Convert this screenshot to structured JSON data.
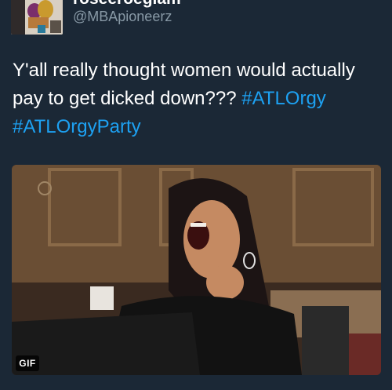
{
  "tweet": {
    "display_name": "roseeroeglam",
    "handle": "@MBApioneerz",
    "text_main": "Y'all really thought women would actually pay to get dicked down??? ",
    "hashtag_1": "#ATLOrgy",
    "hashtag_2": "#ATLOrgyParty",
    "media_badge": "GIF",
    "timestamp": ""
  },
  "colors": {
    "background": "#1b2836",
    "text": "#ffffff",
    "secondary_text": "#8899a6",
    "hashtag": "#1da1f2"
  }
}
